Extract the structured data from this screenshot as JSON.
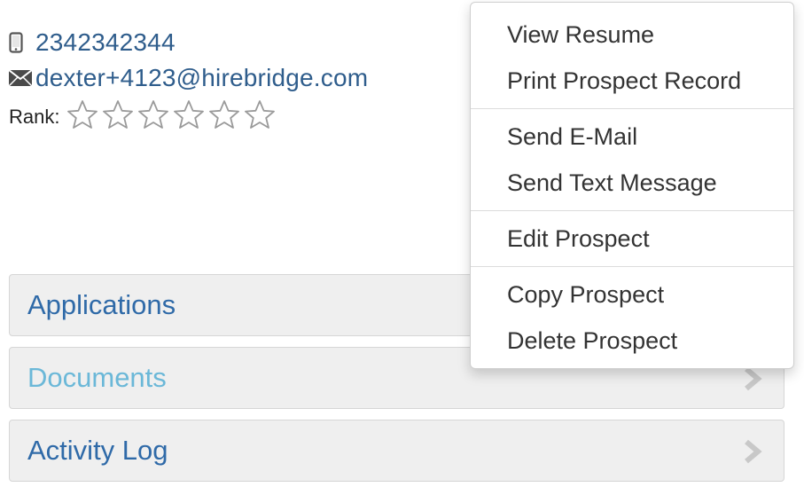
{
  "contact": {
    "phone": "2342342344",
    "email": "dexter+4123@hirebridge.com",
    "rank_label": "Rank:",
    "rank_stars": 6,
    "rank_value": 0
  },
  "panels": [
    {
      "label": "Applications"
    },
    {
      "label": "Documents"
    },
    {
      "label": "Activity Log"
    }
  ],
  "menu": {
    "groups": [
      [
        "View Resume",
        "Print Prospect Record"
      ],
      [
        "Send E-Mail",
        "Send Text Message"
      ],
      [
        "Edit Prospect"
      ],
      [
        "Copy Prospect",
        "Delete Prospect"
      ]
    ]
  },
  "colors": {
    "link": "#2f5d8c",
    "panel_link": "#2f6aa8",
    "panel_link_light": "#6bb8d8",
    "panel_bg": "#efefef"
  },
  "icons": {
    "phone": "mobile-phone-icon",
    "email": "envelope-icon",
    "star": "star-outline-icon",
    "chevron": "chevron-right-icon"
  }
}
